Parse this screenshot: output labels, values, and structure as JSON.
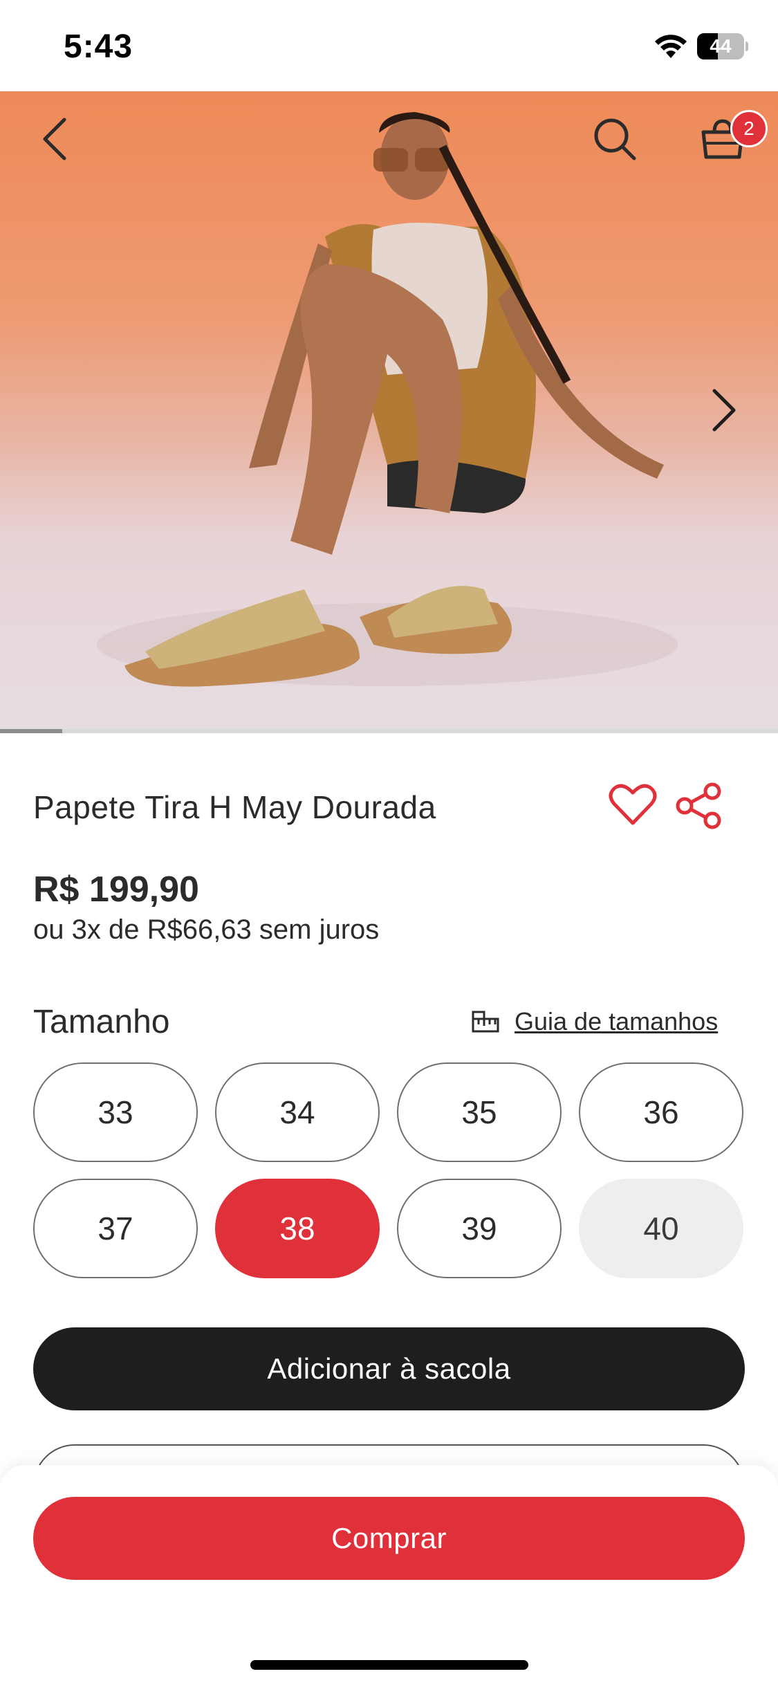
{
  "status_bar": {
    "time": "5:43",
    "battery": "44"
  },
  "header": {
    "bag_count": "2"
  },
  "carousel": {
    "progress": 0.08
  },
  "product": {
    "title": "Papete Tira H May Dourada",
    "price": "R$ 199,90",
    "installments": "ou 3x de R$66,63 sem juros"
  },
  "sizes": {
    "label": "Tamanho",
    "guide_label": "Guia de tamanhos",
    "options": [
      "33",
      "34",
      "35",
      "36",
      "37",
      "38",
      "39",
      "40"
    ],
    "selected": "38",
    "unavailable": [
      "40"
    ]
  },
  "actions": {
    "add_to_bag": "Adicionar à sacola",
    "buy": "Comprar"
  },
  "colors": {
    "brand_red": "#e0303a",
    "dark_button": "#1e1e1e"
  }
}
